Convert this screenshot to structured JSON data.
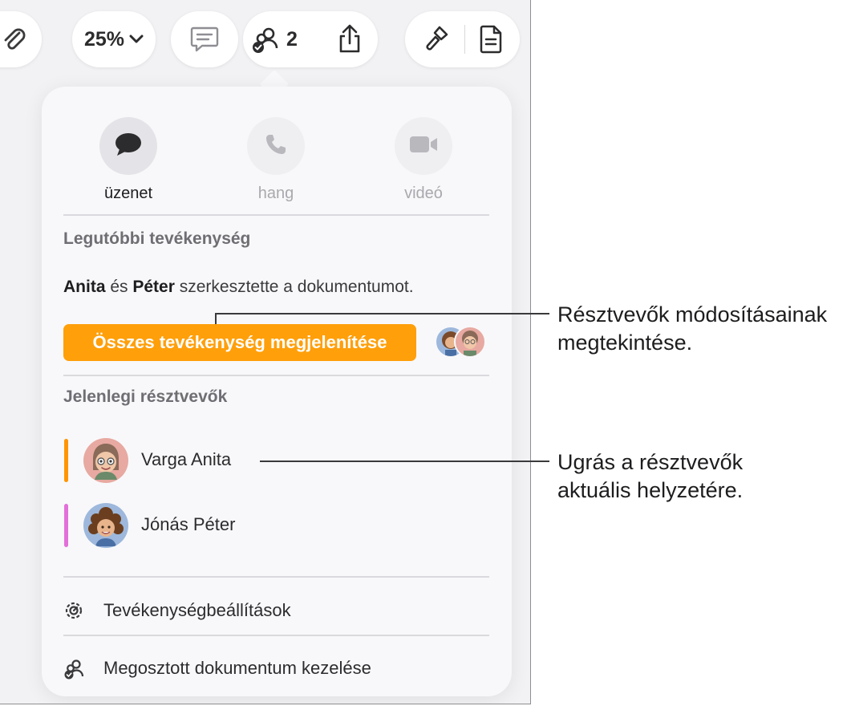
{
  "toolbar": {
    "zoom_level": "25%",
    "collaborator_count": "2"
  },
  "popover": {
    "communication": {
      "message_label": "üzenet",
      "voice_label": "hang",
      "video_label": "videó"
    },
    "recent_activity": {
      "title": "Legutóbbi tevékenység",
      "editor_1": "Anita",
      "conjunction": "és",
      "editor_2": "Péter",
      "summary_rest": "szerkesztette a dokumentumot.",
      "show_all_label": "Összes tevékenység megjelenítése"
    },
    "participants": {
      "title": "Jelenlegi résztvevők",
      "items": [
        {
          "name": "Varga Anita",
          "color": "#ff9500"
        },
        {
          "name": "Jónás Péter",
          "color": "#e36fd9"
        }
      ]
    },
    "menu": {
      "activity_settings": "Tevékenységbeállítások",
      "manage_shared": "Megosztott dokumentum kezelése"
    }
  },
  "callouts": {
    "view_changes": [
      "Résztvevők módosításainak",
      "megtekintése."
    ],
    "jump_to": [
      "Ugrás a résztvevők",
      "aktuális helyzetére."
    ]
  },
  "colors": {
    "accent": "#ff9f0a",
    "participant_1": "#ff9500",
    "participant_2": "#e36fd9"
  }
}
